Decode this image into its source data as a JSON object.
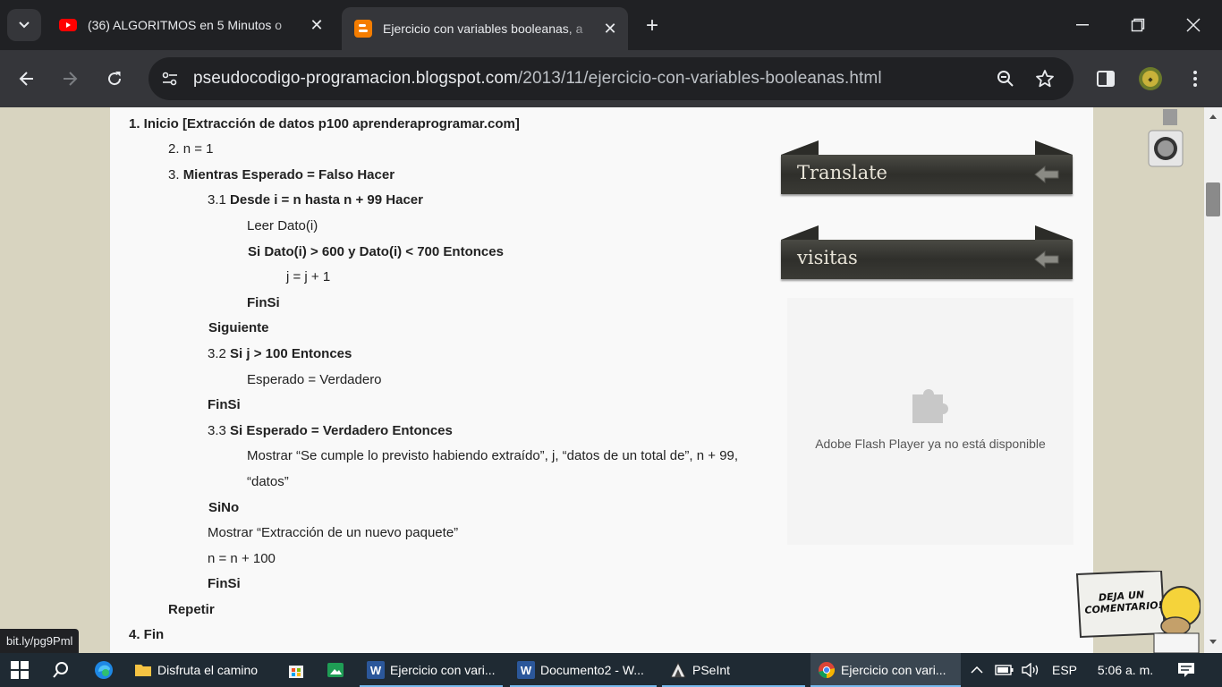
{
  "browser": {
    "tabs": [
      {
        "title": "(36) ALGORITMOS en 5 Minutos o",
        "favicon": "youtube-icon",
        "active": false
      },
      {
        "title": "Ejercicio con variables booleanas, a",
        "favicon": "blogger-icon",
        "active": true
      }
    ],
    "url_domain": "pseudocodigo-programacion.blogspot.com",
    "url_path": "/2013/11/ejercicio-con-variables-booleanas.html",
    "status_url": "bit.ly/pg9Pml"
  },
  "article": {
    "lines": [
      {
        "num": "",
        "text": "1. Inicio [Extracción de datos p100 aprenderaprogramar.com]"
      },
      {
        "num": "2. ",
        "text": "n = 1"
      },
      {
        "num": "3. ",
        "text": "Mientras Esperado = Falso Hacer"
      },
      {
        "num": "3.1 ",
        "text": "Desde i = n hasta n + 99 Hacer"
      },
      {
        "num": "",
        "text": "Leer Dato(i)"
      },
      {
        "num": "",
        "text": "Si Dato(i) > 600 y Dato(i) < 700 Entonces"
      },
      {
        "num": "",
        "text": "j = j + 1"
      },
      {
        "num": "",
        "text": "FinSi"
      },
      {
        "num": "",
        "text": "Siguiente"
      },
      {
        "num": "3.2 ",
        "text": "Si j > 100 Entonces"
      },
      {
        "num": "",
        "text": "Esperado = Verdadero"
      },
      {
        "num": "",
        "text": "FinSi"
      },
      {
        "num": "3.3 ",
        "text": "Si Esperado = Verdadero Entonces"
      },
      {
        "num": "",
        "text": "Mostrar “Se cumple lo previsto habiendo extraído”, j, “datos de un total de”, n + 99,"
      },
      {
        "num": "",
        "text": "“datos”"
      },
      {
        "num": "",
        "text": "SiNo"
      },
      {
        "num": "",
        "text": "Mostrar “Extracción de un nuevo paquete”"
      },
      {
        "num": "",
        "text": "n = n + 100"
      },
      {
        "num": "",
        "text": "FinSi"
      },
      {
        "num": "",
        "text": "Repetir"
      },
      {
        "num": "",
        "text": "4. Fin"
      }
    ]
  },
  "sidebar": {
    "translate_title": "Translate",
    "visitas_title": "visitas",
    "flash_message": "Adobe Flash Player ya no está disponible",
    "comment_sticker": "DEJA UN COMENTARIO!"
  },
  "taskbar": {
    "items": [
      {
        "label": "Disfruta el camino",
        "icon": "folder-icon"
      },
      {
        "label": "",
        "icon": "store-icon"
      },
      {
        "label": "",
        "icon": "image-viewer-icon"
      },
      {
        "label": "Ejercicio con vari...",
        "icon": "word-icon"
      },
      {
        "label": "Documento2 - W...",
        "icon": "word-icon"
      },
      {
        "label": "PSeInt",
        "icon": "pseint-icon"
      },
      {
        "label": "Ejercicio con vari...",
        "icon": "chrome-icon"
      }
    ],
    "language": "ESP",
    "time": "5:06 a. m."
  }
}
